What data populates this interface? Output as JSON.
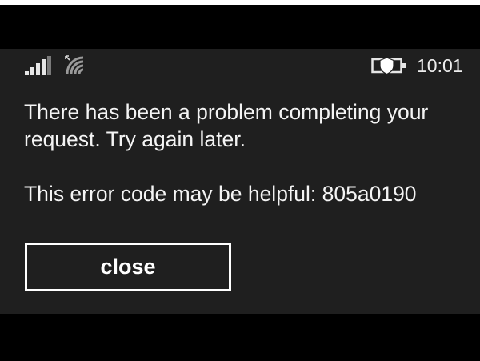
{
  "status_bar": {
    "signal_icon": "signal-bars-icon",
    "wifi_icon": "wifi-icon",
    "battery_icon": "battery-saver-icon",
    "time": "10:01"
  },
  "dialog": {
    "message": "There has been a problem completing your request. Try again later.",
    "error_text": "This error code may be helpful: 805a0190",
    "close_label": "close"
  },
  "colors": {
    "screen_background": "#1f1f1f",
    "frame_background": "#000000",
    "text": "#f4f4f4",
    "button_border": "#ffffff"
  }
}
